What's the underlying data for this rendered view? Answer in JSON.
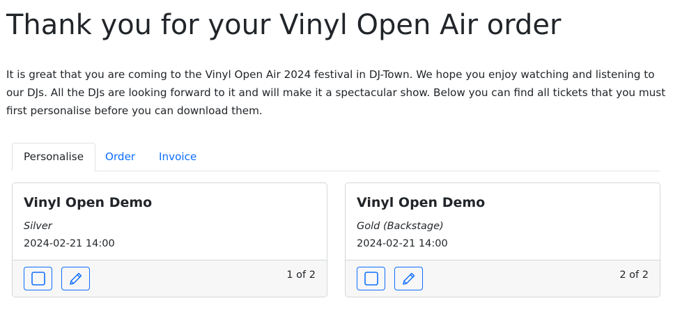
{
  "page": {
    "title": "Thank you for your Vinyl Open Air order",
    "intro": "It is great that you are coming to the Vinyl Open Air 2024 festival in DJ-Town. We hope you enjoy watching and listening to our DJs. All the DJs are looking forward to it and will make it a spectacular show. Below you can find all tickets that you must first personalise before you can download them."
  },
  "tabs": [
    {
      "label": "Personalise",
      "active": true
    },
    {
      "label": "Order",
      "active": false
    },
    {
      "label": "Invoice",
      "active": false
    }
  ],
  "tickets": [
    {
      "event": "Vinyl Open Demo",
      "type": "Silver",
      "datetime": "2024-02-21 14:00",
      "counter": "1 of 2",
      "actions": [
        "checkbox-icon",
        "pencil-icon"
      ]
    },
    {
      "event": "Vinyl Open Demo",
      "type": "Gold (Backstage)",
      "datetime": "2024-02-21 14:00",
      "counter": "2 of 2",
      "actions": [
        "checkbox-icon",
        "pencil-icon"
      ]
    }
  ],
  "colors": {
    "accent": "#0d6efd",
    "text": "#212529",
    "border": "#d3d6da",
    "footer": "#f7f7f7"
  }
}
